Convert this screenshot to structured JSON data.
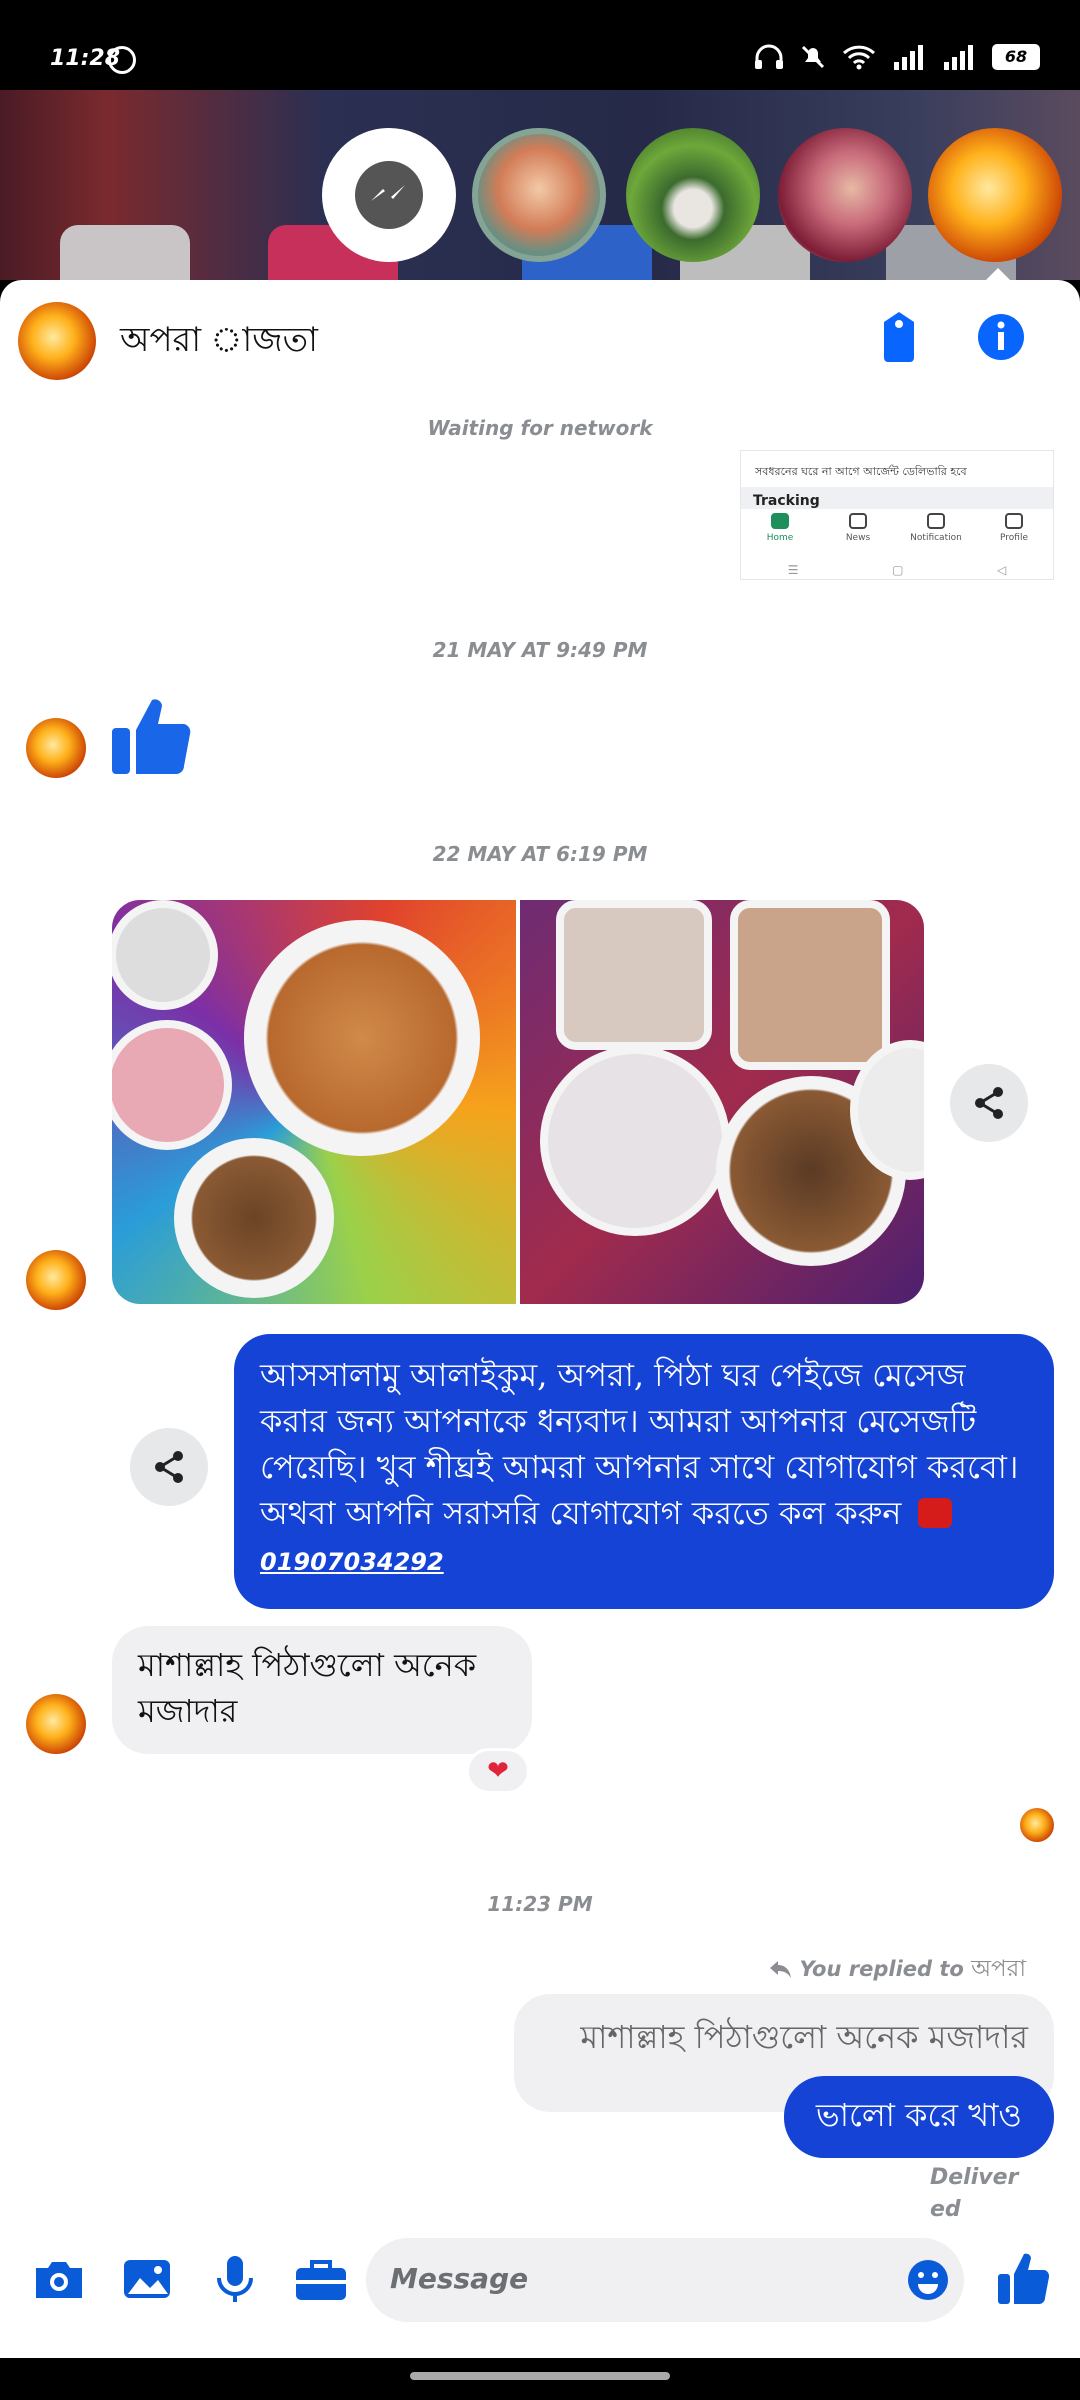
{
  "status_bar": {
    "time": "11:28",
    "battery": "68"
  },
  "header": {
    "contact_name": "অপরা াজতা"
  },
  "messages": {
    "network_status": "Waiting for network",
    "shared_preview": {
      "text": "সবধরনের ঘরে না আগে আর্জেন্ট ডেলিভারি হবে",
      "section": "Tracking",
      "tabs": [
        "Home",
        "News",
        "Notification",
        "Profile"
      ],
      "nav": [
        "☰",
        "▢",
        "◁"
      ]
    },
    "timestamp_1": "21 MAY AT 9:49 PM",
    "timestamp_2": "22 MAY AT 6:19 PM",
    "auto_reply": "আসসালামু আলাইকুম, অপরা, পিঠা ঘর পেইজে মেসেজ করার জন্য আপনাকে ধন্যবাদ। আমরা আপনার মেসেজটি পেয়েছি। খুব শীঘ্রই আমরা আপনার সাথে যোগাযোগ করবো। অথবা আপনি সরাসরি যোগাযোগ করতে কল করুন",
    "phone": "01907034292",
    "incoming": "মাশাল্লাহ পিঠাগুলো অনেক মজাদার",
    "reaction": "❤",
    "timestamp_3": "11:23 PM",
    "replied_label": "You replied to",
    "replied_to": "অপরা",
    "quoted_text": "মাশাল্লাহ পিঠাগুলো অনেক মজাদার",
    "reply": "ভালো করে খাও",
    "delivered": "Delivered"
  },
  "composer": {
    "placeholder": "Message"
  },
  "colors": {
    "accent": "#1443d6",
    "messenger_blue": "#0866ff"
  }
}
